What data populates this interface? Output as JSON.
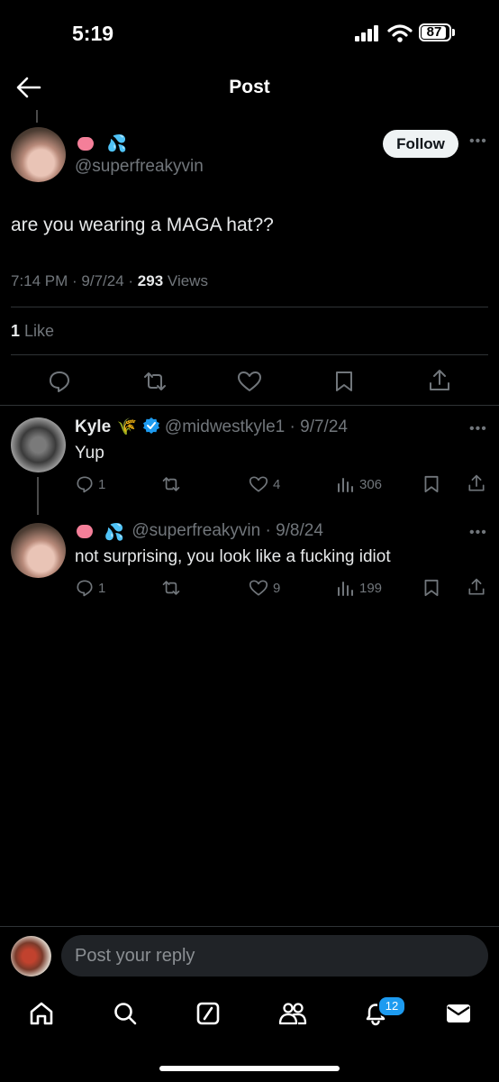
{
  "status_bar": {
    "time": "5:19",
    "battery": "87"
  },
  "header": {
    "title": "Post"
  },
  "post": {
    "handle": "@superfreakyvin",
    "follow_label": "Follow",
    "text": "are you wearing a MAGA hat??",
    "time": "7:14 PM",
    "date": "9/7/24",
    "views_count": "293",
    "views_label": "Views",
    "likes_count": "1",
    "likes_label": "Like"
  },
  "replies": [
    {
      "name": "Kyle",
      "handle": "@midwestkyle1",
      "date": "9/7/24",
      "text": "Yup",
      "reply_count": "1",
      "like_count": "4",
      "view_count": "306"
    },
    {
      "handle": "@superfreakyvin",
      "date": "9/8/24",
      "text": "not surprising, you look like a fucking idiot",
      "reply_count": "1",
      "like_count": "9",
      "view_count": "199"
    }
  ],
  "composer": {
    "placeholder": "Post your reply"
  },
  "tab_bar": {
    "notifications_badge": "12"
  },
  "colors": {
    "background": "#000000",
    "accent": "#1d9bf0",
    "muted": "#71767b",
    "text": "#e7e9ea"
  },
  "icons": [
    "back-arrow-icon",
    "more-icon",
    "comment-icon",
    "retweet-icon",
    "heart-icon",
    "bookmark-icon",
    "share-icon",
    "views-icon",
    "home-icon",
    "search-icon",
    "compose-icon",
    "communities-icon",
    "bell-icon",
    "mail-icon",
    "verified-badge-icon",
    "grain-icon"
  ]
}
